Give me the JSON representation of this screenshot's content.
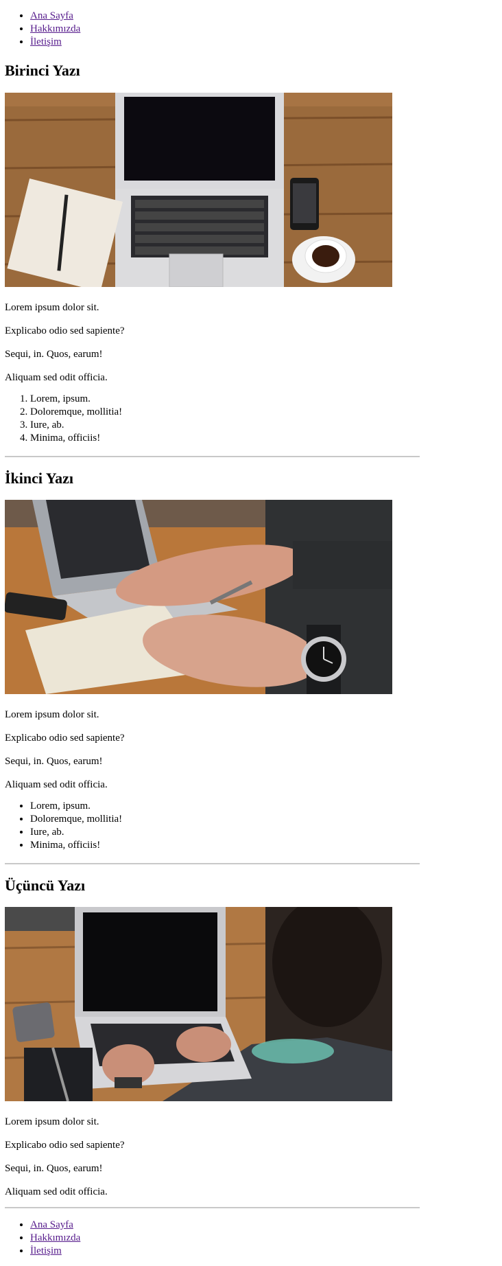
{
  "nav_top": [
    "Ana Sayfa",
    "Hakkımızda",
    "İletişim"
  ],
  "nav_bottom": [
    "Ana Sayfa",
    "Hakkımızda",
    "İletişim"
  ],
  "posts": [
    {
      "title": "Birinci Yazı",
      "paragraphs": [
        "Lorem ipsum dolor sit.",
        "Explicabo odio sed sapiente?",
        "Sequi, in. Quos, earum!",
        "Aliquam sed odit officia."
      ],
      "list": [
        "Lorem, ipsum.",
        "Doloremque, mollitia!",
        "Iure, ab.",
        "Minima, officiis!"
      ]
    },
    {
      "title": "İkinci Yazı",
      "paragraphs": [
        "Lorem ipsum dolor sit.",
        "Explicabo odio sed sapiente?",
        "Sequi, in. Quos, earum!",
        "Aliquam sed odit officia."
      ],
      "list": [
        "Lorem, ipsum.",
        "Doloremque, mollitia!",
        "Iure, ab.",
        "Minima, officiis!"
      ]
    },
    {
      "title": "Üçüncü Yazı",
      "paragraphs": [
        "Lorem ipsum dolor sit.",
        "Explicabo odio sed sapiente?",
        "Sequi, in. Quos, earum!",
        "Aliquam sed odit officia."
      ]
    }
  ]
}
